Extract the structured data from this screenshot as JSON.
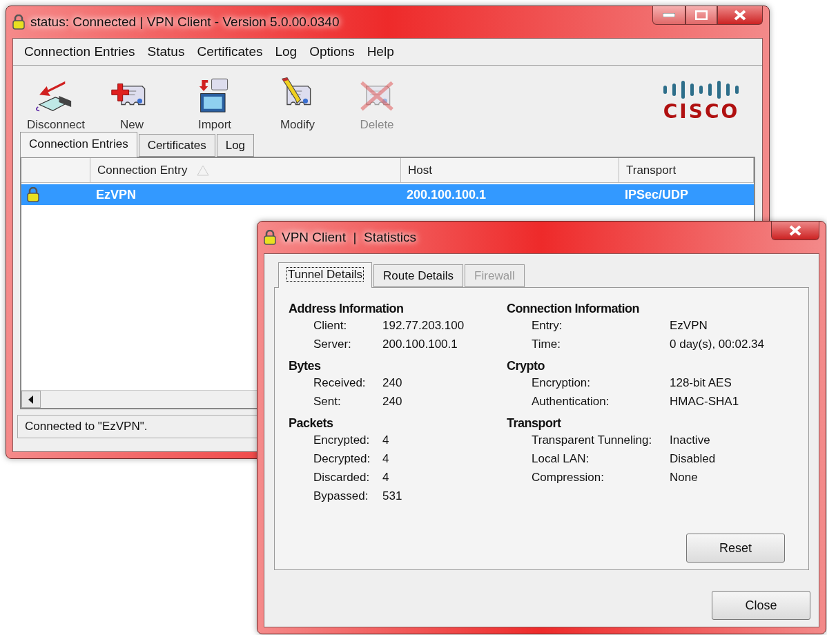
{
  "main_window": {
    "title": "status: Connected | VPN Client - Version 5.0.00.0340",
    "menu": [
      "Connection Entries",
      "Status",
      "Certificates",
      "Log",
      "Options",
      "Help"
    ],
    "toolbar": [
      {
        "kind": "disconnect",
        "label": "Disconnect",
        "disabled": false
      },
      {
        "kind": "new",
        "label": "New",
        "disabled": false
      },
      {
        "kind": "import",
        "label": "Import",
        "disabled": false
      },
      {
        "kind": "modify",
        "label": "Modify",
        "disabled": false
      },
      {
        "kind": "delete",
        "label": "Delete",
        "disabled": true
      }
    ],
    "logo_text": "CISCO",
    "tabs": [
      {
        "label": "Connection Entries",
        "selected": true
      },
      {
        "label": "Certificates",
        "selected": false
      },
      {
        "label": "Log",
        "selected": false
      }
    ],
    "table": {
      "columns": [
        {
          "label": "Connection Entry",
          "sorted": true
        },
        {
          "label": "Host",
          "sorted": false
        },
        {
          "label": "Transport",
          "sorted": false
        }
      ],
      "rows": [
        {
          "connected": true,
          "entry": "EzVPN",
          "host": "200.100.100.1",
          "transport": "IPSec/UDP",
          "selected": true
        }
      ]
    },
    "status_bar": "Connected to \"EzVPN\"."
  },
  "stats_window": {
    "title": "VPN Client  |  Statistics",
    "tabs": [
      {
        "label": "Tunnel Details",
        "selected": true,
        "disabled": false
      },
      {
        "label": "Route Details",
        "selected": false,
        "disabled": false
      },
      {
        "label": "Firewall",
        "selected": false,
        "disabled": true
      }
    ],
    "left_sections": [
      {
        "title": "Address Information",
        "rows": [
          {
            "label": "Client:",
            "value": "192.77.203.100"
          },
          {
            "label": "Server:",
            "value": "200.100.100.1"
          }
        ]
      },
      {
        "title": "Bytes",
        "rows": [
          {
            "label": "Received:",
            "value": "240"
          },
          {
            "label": "Sent:",
            "value": "240"
          }
        ]
      },
      {
        "title": "Packets",
        "rows": [
          {
            "label": "Encrypted:",
            "value": "4"
          },
          {
            "label": "Decrypted:",
            "value": "4"
          },
          {
            "label": "Discarded:",
            "value": "4"
          },
          {
            "label": "Bypassed:",
            "value": "531"
          }
        ]
      }
    ],
    "right_sections": [
      {
        "title": "Connection Information",
        "rows": [
          {
            "label": "Entry:",
            "value": "EzVPN"
          },
          {
            "label": "Time:",
            "value": "0 day(s), 00:02.34"
          }
        ]
      },
      {
        "title": "Crypto",
        "rows": [
          {
            "label": "Encryption:",
            "value": "128-bit AES"
          },
          {
            "label": "Authentication:",
            "value": "HMAC-SHA1"
          }
        ]
      },
      {
        "title": "Transport",
        "rows": [
          {
            "label": "Transparent Tunneling:",
            "value": "Inactive"
          },
          {
            "label": "Local LAN:",
            "value": "Disabled"
          },
          {
            "label": "Compression:",
            "value": "None"
          }
        ]
      }
    ],
    "reset_button": "Reset",
    "close_button": "Close"
  }
}
